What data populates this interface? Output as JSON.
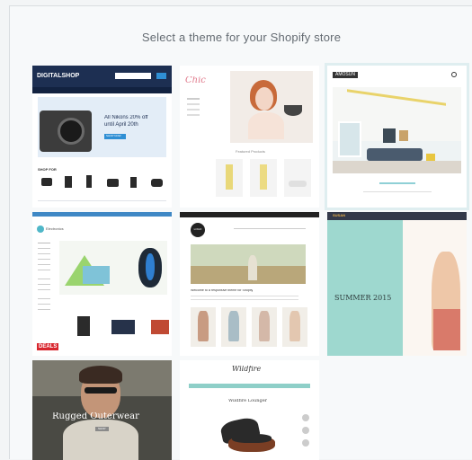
{
  "page": {
    "heading": "Select a theme for your Shopify store"
  },
  "themes": {
    "digitalshop": {
      "logo": "DIGITALSHOP",
      "promo": "All Nikons 20% off\nuntil April 20th",
      "cta": "SHOP NOW",
      "section": "SHOP FOR"
    },
    "boutique": {
      "logo": "Chic",
      "section": "Featured Products"
    },
    "modern": {
      "logo": "AMOSUN"
    },
    "tech": {
      "logo": "Electronics",
      "badge": "DEALS"
    },
    "blog": {
      "logo": "LOGO",
      "headline": "Welcome to a responsive theme for Shopify"
    },
    "fashion": {
      "logo": "SUSAN",
      "promo": "SUMMER 2015"
    },
    "outdoor": {
      "headline": "Rugged Outerwear",
      "cta": "SHOP"
    },
    "furniture": {
      "logo": "Wildfire",
      "title": "Wildfire Lounger"
    }
  },
  "colors": {
    "navy": "#1d2f52",
    "mint": "#9ed8cf",
    "teal_selected": "#dfeef0"
  }
}
